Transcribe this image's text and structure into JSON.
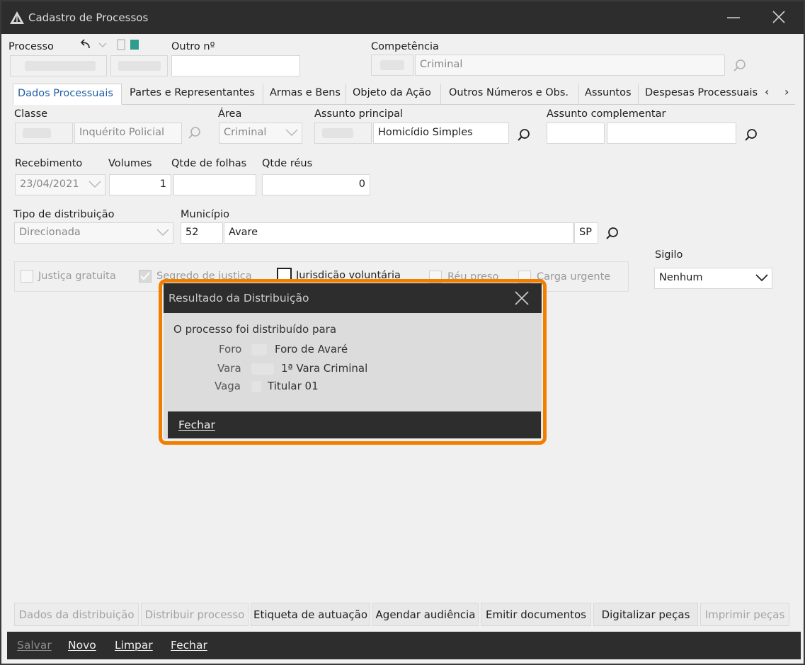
{
  "window": {
    "title": "Cadastro de Processos"
  },
  "header": {
    "processo_label": "Processo",
    "outro_label": "Outro nº",
    "competencia_label": "Competência",
    "competencia_value": "Criminal"
  },
  "tabs": [
    {
      "label": "Dados Processuais"
    },
    {
      "label": "Partes e Representantes"
    },
    {
      "label": "Armas e Bens"
    },
    {
      "label": "Objeto da Ação"
    },
    {
      "label": "Outros Números e Obs."
    },
    {
      "label": "Assuntos"
    },
    {
      "label": "Despesas Processuais"
    }
  ],
  "tab_nav": {
    "prev": "‹",
    "next": "›"
  },
  "form": {
    "classe_label": "Classe",
    "classe_value": "Inquérito Policial",
    "area_label": "Área",
    "area_value": "Criminal",
    "assunto_principal_label": "Assunto principal",
    "assunto_principal_value": "Homicídio Simples",
    "assunto_complementar_label": "Assunto complementar",
    "recebimento_label": "Recebimento",
    "recebimento_value": "23/04/2021",
    "volumes_label": "Volumes",
    "volumes_value": "1",
    "qtde_folhas_label": "Qtde de folhas",
    "qtde_reus_label": "Qtde réus",
    "qtde_reus_value": "0",
    "tipo_distribuicao_label": "Tipo de distribuição",
    "tipo_distribuicao_value": "Direcionada",
    "municipio_label": "Município",
    "municipio_code": "52",
    "municipio_name": "Avare",
    "municipio_uf": "SP",
    "sigilo_label": "Sigilo",
    "sigilo_value": "Nenhum"
  },
  "checkboxes": [
    {
      "label": "Justiça gratuita"
    },
    {
      "label": "Segredo de justiça"
    },
    {
      "label": "Jurisdição voluntária"
    },
    {
      "label": "Réu preso"
    },
    {
      "label": "Carga urgente"
    }
  ],
  "dialog": {
    "title": "Resultado da Distribuição",
    "message": "O processo foi distribuído para",
    "foro_label": "Foro",
    "foro_value": "Foro de Avaré",
    "vara_label": "Vara",
    "vara_value": "1ª Vara Criminal",
    "vaga_label": "Vaga",
    "vaga_value": "Titular 01",
    "close_button": "Fechar"
  },
  "action_buttons": [
    {
      "label": "Dados da distribuição"
    },
    {
      "label": "Distribuir processo"
    },
    {
      "label": "Etiqueta de autuação"
    },
    {
      "label": "Agendar audiência"
    },
    {
      "label": "Emitir documentos"
    },
    {
      "label": "Digitalizar peças"
    },
    {
      "label": "Imprimir peças"
    }
  ],
  "bottom_buttons": [
    {
      "label": "Salvar"
    },
    {
      "label": "Novo"
    },
    {
      "label": "Limpar"
    },
    {
      "label": "Fechar"
    }
  ]
}
